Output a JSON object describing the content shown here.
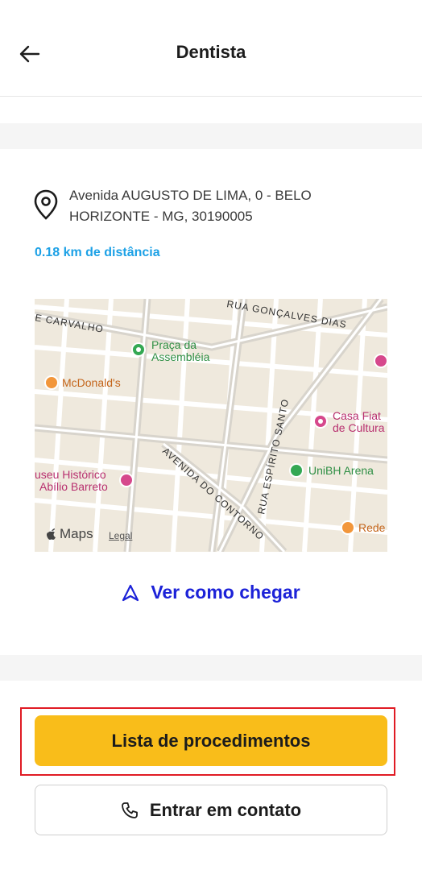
{
  "header": {
    "title": "Dentista",
    "back_icon": "arrow-left-icon"
  },
  "location": {
    "address": "Avenida AUGUSTO DE LIMA, 0 - BELO HORIZONTE - MG, 30190005",
    "distance": "0.18 km de distância",
    "pin_icon": "location-pin-icon"
  },
  "map": {
    "streets": [
      {
        "id": "street_goncalves",
        "label": "RUA GONÇALVES DIAS"
      },
      {
        "id": "street_carvalho",
        "label": "E CARVALHO"
      },
      {
        "id": "street_espirito",
        "label": "RUA ESPÍRITO SANTO"
      },
      {
        "id": "street_contorno",
        "label": "AVENIDA DO CONTORNO"
      }
    ],
    "pois": {
      "praca_line1": "Praça da",
      "praca_line2": "Assembléia",
      "mcdonalds": "McDonald's",
      "casa_line1": "Casa Fiat",
      "casa_line2": "de Cultura",
      "unibh": "UniBH Arena",
      "museu_line1": "useu Histórico",
      "museu_line2": "Abílio Barreto",
      "rede": "Rede"
    },
    "logo": "Maps",
    "legal": "Legal",
    "colors": {
      "background": "#efe9dd",
      "roads": "#ffffff",
      "major_roads": "#d8d4cc",
      "poi_green": "#34a853",
      "poi_orange": "#f2963a",
      "poi_pink": "#d6488c"
    }
  },
  "route": {
    "label": "Ver como chegar",
    "icon": "navigation-arrow-icon"
  },
  "actions": {
    "procedures_label": "Lista de procedimentos",
    "contact_label": "Entrar em contato",
    "contact_icon": "phone-icon"
  },
  "colors": {
    "accent_yellow": "#f9bd1a",
    "link_blue": "#1c22d8",
    "distance_blue": "#1da1e6",
    "highlight_red": "#e01b24"
  }
}
